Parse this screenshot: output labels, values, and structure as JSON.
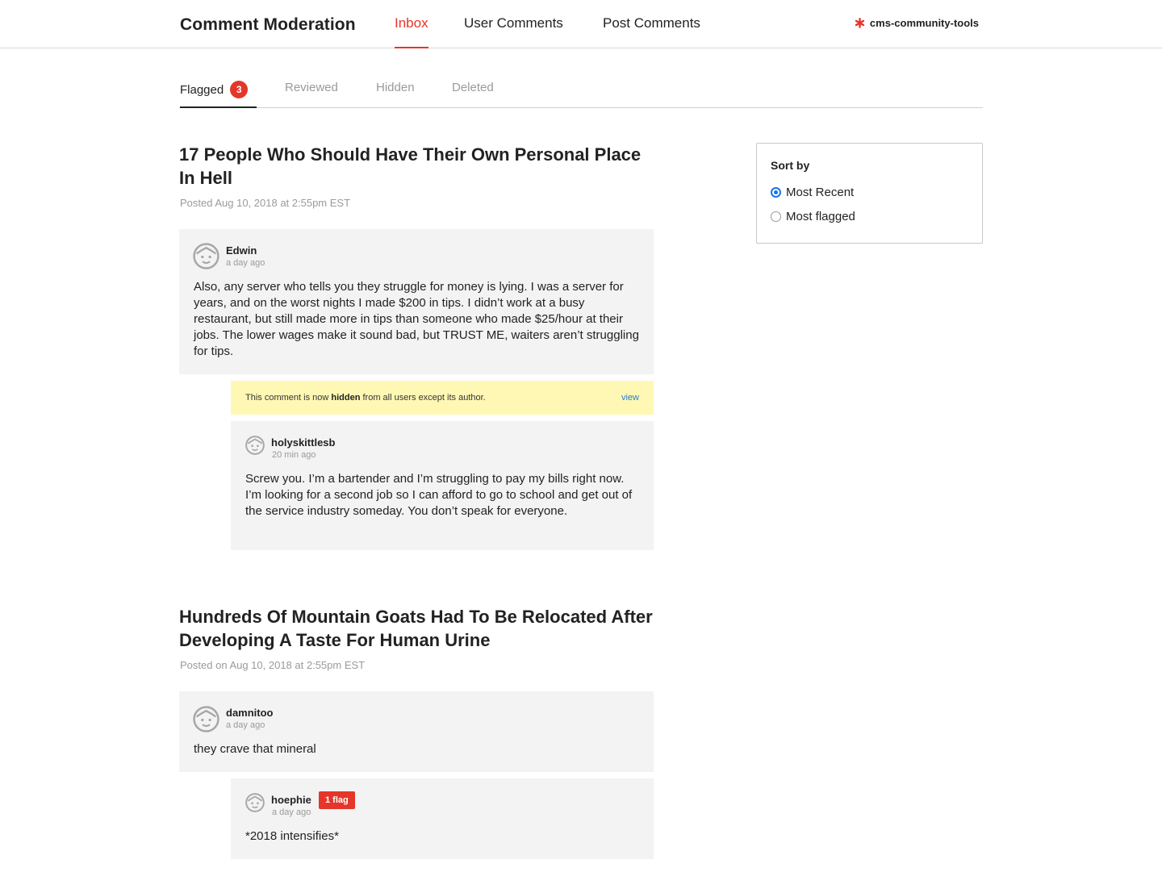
{
  "header": {
    "app_title": "Comment Moderation",
    "nav": [
      {
        "label": "Inbox",
        "active": true
      },
      {
        "label": "User Comments",
        "active": false
      },
      {
        "label": "Post Comments",
        "active": false
      }
    ],
    "brand": {
      "label": "cms-community-tools",
      "icon": "asterisk-icon"
    }
  },
  "tabs": {
    "flagged": {
      "label": "Flagged",
      "count": "3"
    },
    "reviewed": {
      "label": "Reviewed"
    },
    "hidden": {
      "label": "Hidden"
    },
    "deleted": {
      "label": "Deleted"
    }
  },
  "sort": {
    "title": "Sort by",
    "options": [
      {
        "label": "Most Recent",
        "selected": true
      },
      {
        "label": "Most flagged",
        "selected": false
      }
    ]
  },
  "articles": [
    {
      "title": "17 People Who Should Have Their Own Personal Place In Hell",
      "posted": "Posted Aug 10, 2018 at 2:55pm EST",
      "comment": {
        "author": "Edwin",
        "time": "a day ago",
        "text": "Also, any server who tells you they struggle for money is lying. I was a server for years, and on the worst nights I made $200 in tips. I didn’t work at a busy restaurant, but still made more in tips than someone who made $25/hour at their jobs. The lower wages make it sound bad, but TRUST ME, waiters aren’t struggling for tips."
      },
      "notice": {
        "prefix": "This comment is now ",
        "bold": "hidden",
        "suffix": " from all users except its author.",
        "action": "view"
      },
      "reply": {
        "author": "holyskittlesb",
        "time": "20 min ago",
        "text": "Screw you. I’m a bartender and I’m struggling to pay my bills right now. I’m looking for a second job so I can afford to go to school and get out of the service industry someday. You don’t speak for everyone."
      }
    },
    {
      "title": "Hundreds Of Mountain Goats Had To Be Relocated After Developing A Taste For Human Urine",
      "posted": "Posted on Aug 10, 2018 at 2:55pm EST",
      "comment": {
        "author": "damnitoo",
        "time": "a day ago",
        "text": "they crave that mineral"
      },
      "reply": {
        "author": "hoephie",
        "flag": "1 flag",
        "time": "a day ago",
        "text": "*2018 intensifies*"
      }
    }
  ],
  "colors": {
    "accent": "#e4362a",
    "radio": "#1a73e8",
    "notice_bg": "#fff8b4",
    "card_bg": "#f3f3f3",
    "link": "#2a7bd0"
  }
}
